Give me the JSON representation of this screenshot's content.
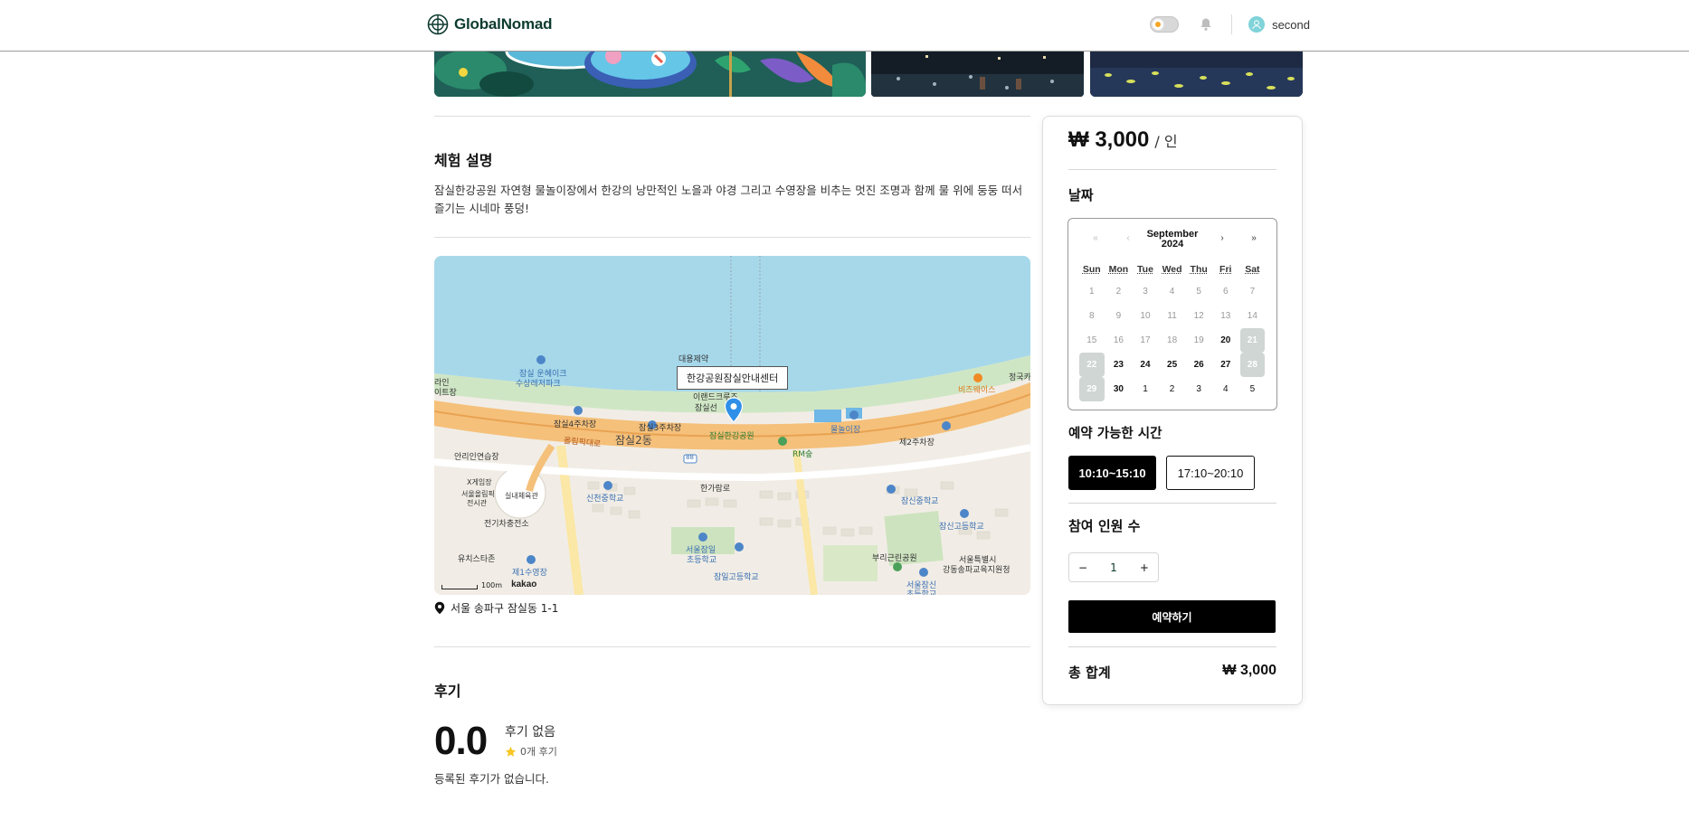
{
  "header": {
    "logo_text": "GlobalNomad",
    "username": "second"
  },
  "description": {
    "title": "체험 설명",
    "text": "잠실한강공원 자연형 물놀이장에서 한강의 낭만적인 노을과 야경 그리고 수영장을 비추는 멋진 조명과 함께 물 위에 둥둥 떠서 즐기는 시네마 풍덩!"
  },
  "map": {
    "tooltip": "한강공원잠실안내센터",
    "scale": "100m",
    "brand": "kakao",
    "labels": {
      "l1": "대용제약",
      "l2": "잠실 운혜이크",
      "l3": "수상레저파크",
      "l4": "잠실4주차장",
      "l5": "잠실3주차장",
      "l6": "잠실2동",
      "l7": "잠실한강공원",
      "l8": "물놀이장",
      "l9": "제2주차장",
      "l10": "RM숲",
      "l11": "신천중학교",
      "l12": "잠신중학교",
      "l13": "잠신고등학교",
      "l14": "서울잠일",
      "l15": "초등학교",
      "l16": "잠일고등학교",
      "l17": "부리근린공원",
      "l18": "서울특별시",
      "l19": "강동송파교육지원청",
      "l20": "실내체육관",
      "l21": "전기차충전소",
      "l22": "유치스타존",
      "l23": "제1수영장",
      "l24": "안리인연습장",
      "l25": "올림픽대로",
      "l26": "한가람로",
      "l27": "비즈웨이스",
      "l28": "정국카",
      "l29": "서울잠신",
      "l30": "초등학교",
      "l31": "X게임장",
      "l32": "서울올림픽",
      "l33": "전시관",
      "l34": "라인",
      "l35": "이트장",
      "l36": "88",
      "l37": "잠실선",
      "l38": "이랜드크루즈"
    }
  },
  "address": "서울 송파구 잠실동 1-1",
  "reviews": {
    "title": "후기",
    "rating": "0.0",
    "label": "후기 없음",
    "count": "0개 후기",
    "empty": "등록된 후기가 없습니다."
  },
  "booking": {
    "price": "₩ 3,000",
    "per": "/ 인",
    "date_title": "날짜",
    "calendar": {
      "month": "September",
      "year": "2024",
      "nav": [
        "«",
        "‹",
        "›",
        "»"
      ],
      "weekdays": [
        "Sun",
        "Mon",
        "Tue",
        "Wed",
        "Thu",
        "Fri",
        "Sat"
      ],
      "weeks": [
        [
          "1",
          "2",
          "3",
          "4",
          "5",
          "6",
          "7"
        ],
        [
          "8",
          "9",
          "10",
          "11",
          "12",
          "13",
          "14"
        ],
        [
          "15",
          "16",
          "17",
          "18",
          "19",
          "20",
          "21"
        ],
        [
          "22",
          "23",
          "24",
          "25",
          "26",
          "27",
          "28"
        ],
        [
          "29",
          "30",
          "1",
          "2",
          "3",
          "4",
          "5"
        ]
      ]
    },
    "time_title": "예약 가능한 시간",
    "times": [
      "10:10~15:10",
      "17:10~20:10"
    ],
    "people_title": "참여 인원 수",
    "stepper": {
      "minus": "−",
      "value": "1",
      "plus": "+"
    },
    "reserve": "예약하기",
    "total_label": "총 합계",
    "total": "₩ 3,000"
  },
  "colors": {
    "accent": "#000000",
    "brand": "#0d3b2e",
    "selected_day": "#cfd6d3",
    "water": "#a6d8ea",
    "road": "#f5c07a"
  },
  "icons": {
    "logo": "globe-logo-icon",
    "theme": "sun-toggle-icon",
    "notification": "bell-icon",
    "avatar": "user-avatar-icon",
    "location": "map-pin-icon",
    "star": "star-icon"
  }
}
